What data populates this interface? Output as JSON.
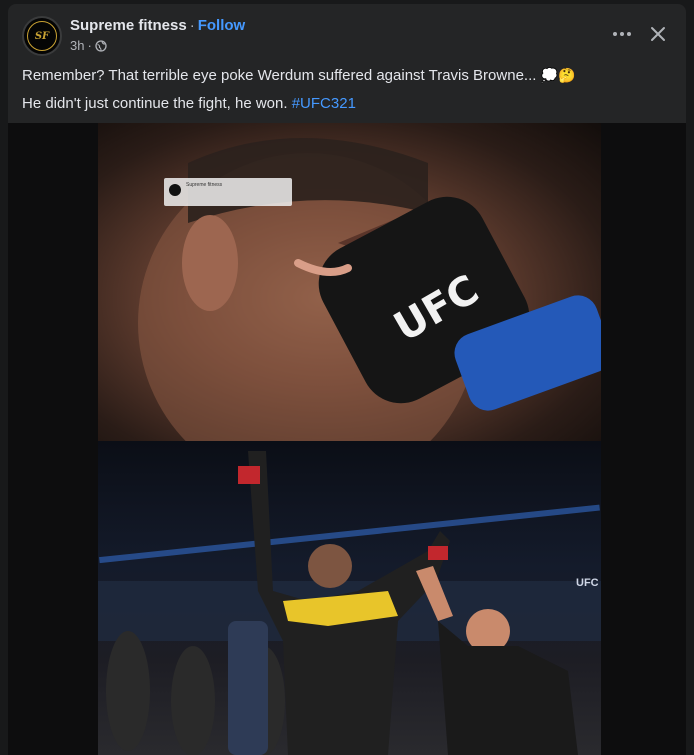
{
  "post": {
    "author": "Supreme fitness",
    "separator": "·",
    "follow_label": "Follow",
    "time": "3h",
    "meta_separator": "·",
    "avatar_initials": "SF",
    "text_line1": "Remember? That terrible eye poke Werdum suffered against Travis Browne...",
    "emojis": "💭🤔",
    "text_line2": "He didn't just continue the fight, he won.",
    "hashtag": "#UFC321"
  },
  "icons": {
    "more": "more-options-icon",
    "close": "close-icon",
    "globe": "globe-icon"
  },
  "image": {
    "glove_logo": "UFC",
    "watermark_name": "Supreme fitness",
    "background_banner": "UFC"
  },
  "colors": {
    "accent": "#4599ff",
    "card_bg": "#242526",
    "page_bg": "#18191a",
    "text": "#e4e6eb",
    "secondary_text": "#b0b3b8"
  }
}
